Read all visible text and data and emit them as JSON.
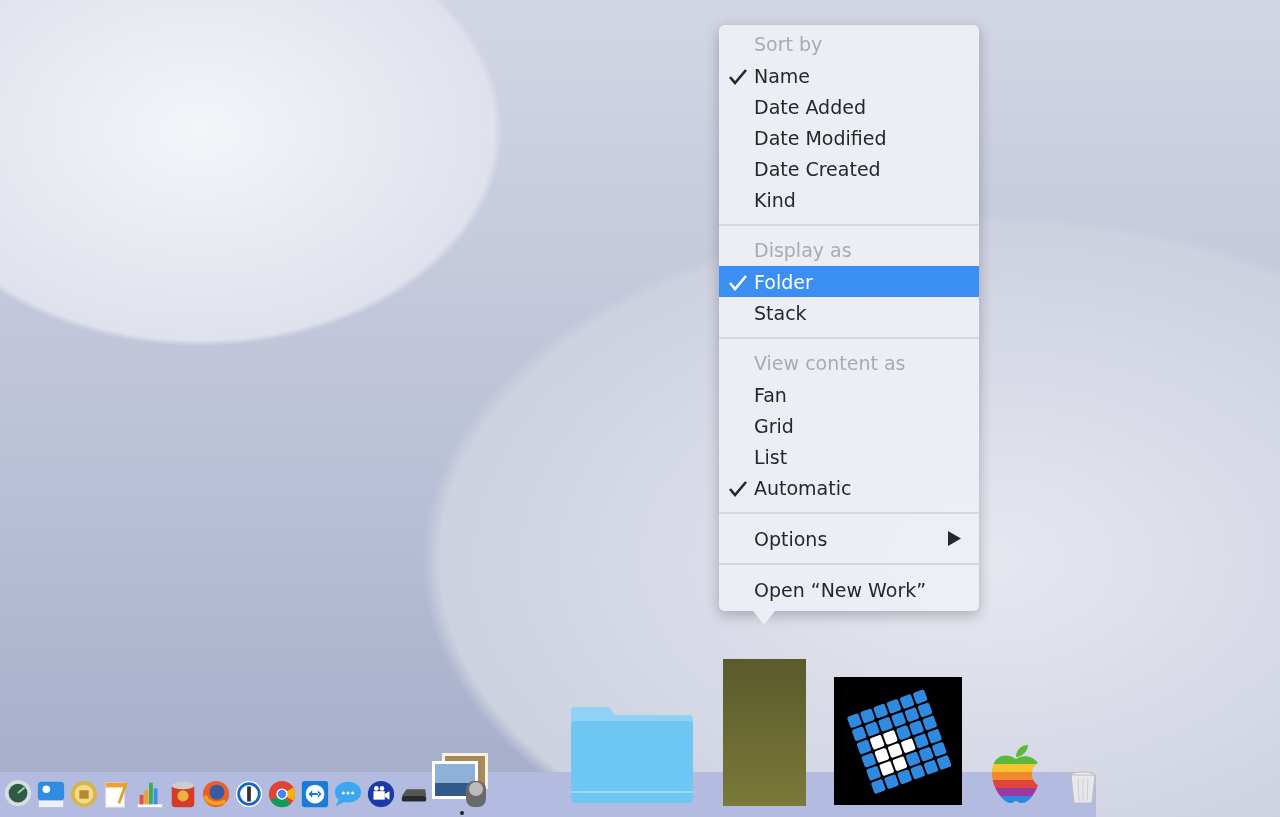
{
  "menu": {
    "sections": [
      {
        "heading": "Sort by",
        "items": [
          {
            "label": "Name",
            "checked": true,
            "selected": false
          },
          {
            "label": "Date Added",
            "checked": false,
            "selected": false
          },
          {
            "label": "Date Modified",
            "checked": false,
            "selected": false
          },
          {
            "label": "Date Created",
            "checked": false,
            "selected": false
          },
          {
            "label": "Kind",
            "checked": false,
            "selected": false
          }
        ]
      },
      {
        "heading": "Display as",
        "items": [
          {
            "label": "Folder",
            "checked": true,
            "selected": true
          },
          {
            "label": "Stack",
            "checked": false,
            "selected": false
          }
        ]
      },
      {
        "heading": "View content as",
        "items": [
          {
            "label": "Fan",
            "checked": false,
            "selected": false
          },
          {
            "label": "Grid",
            "checked": false,
            "selected": false
          },
          {
            "label": "List",
            "checked": false,
            "selected": false
          },
          {
            "label": "Automatic",
            "checked": true,
            "selected": false
          }
        ]
      },
      {
        "items": [
          {
            "label": "Options",
            "checked": false,
            "selected": false,
            "submenu": true
          }
        ]
      },
      {
        "items": [
          {
            "label": "Open “New Work”",
            "checked": false,
            "selected": false,
            "submenu": false
          }
        ]
      }
    ]
  },
  "dock": {
    "apps": [
      {
        "kind": "gauge",
        "running": false
      },
      {
        "kind": "scanner",
        "running": false
      },
      {
        "kind": "coin",
        "running": false
      },
      {
        "kind": "notepad",
        "running": false
      },
      {
        "kind": "chart",
        "running": false
      },
      {
        "kind": "can",
        "running": false
      },
      {
        "kind": "fox",
        "running": false
      },
      {
        "kind": "ring",
        "running": false
      },
      {
        "kind": "wheel",
        "running": false
      },
      {
        "kind": "arrows",
        "running": false
      },
      {
        "kind": "bubble",
        "running": false
      },
      {
        "kind": "camera",
        "running": false
      },
      {
        "kind": "drive",
        "running": false
      },
      {
        "kind": "photos",
        "running": true
      }
    ],
    "stacks": [
      {
        "kind": "folder"
      },
      {
        "kind": "picture"
      },
      {
        "kind": "globe"
      },
      {
        "kind": "apple"
      },
      {
        "kind": "trash"
      }
    ]
  }
}
